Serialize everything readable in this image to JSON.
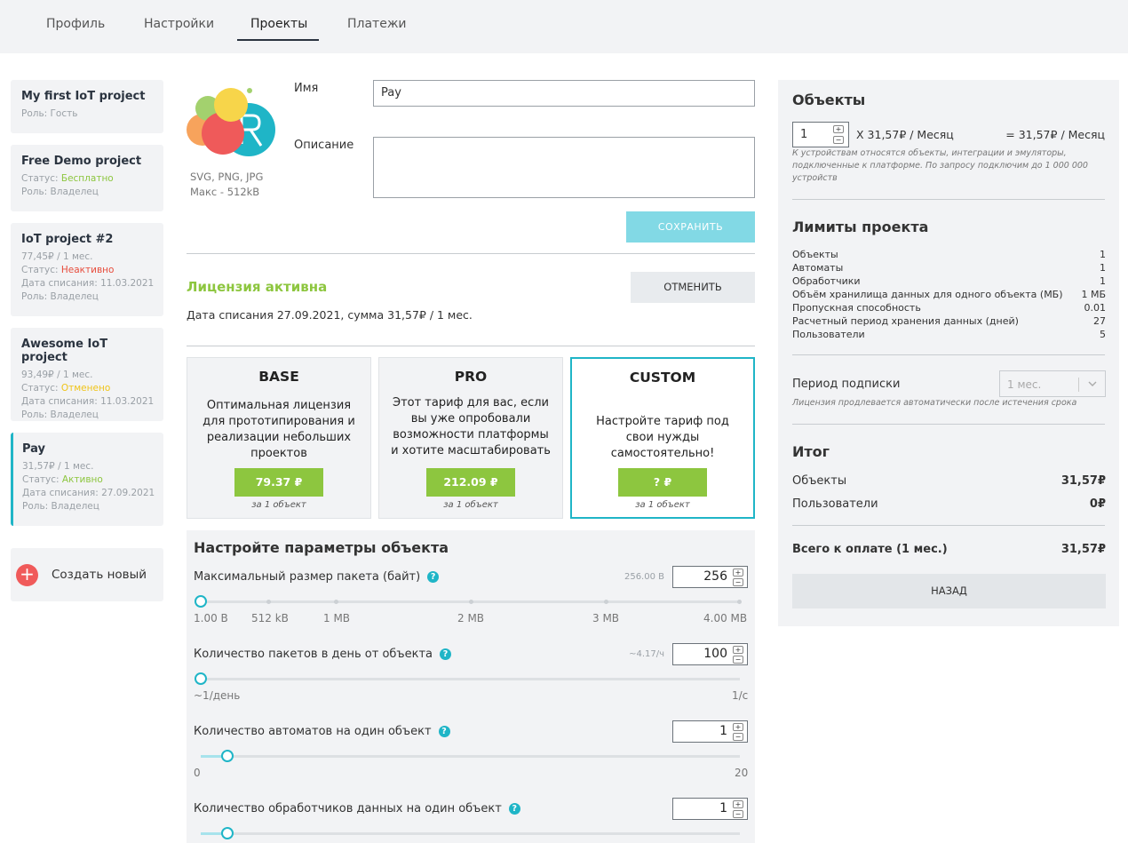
{
  "tabs": [
    {
      "label": "Профиль"
    },
    {
      "label": "Настройки"
    },
    {
      "label": "Проекты"
    },
    {
      "label": "Платежи"
    }
  ],
  "projects": [
    {
      "title": "My first IoT project",
      "role": "Роль: Гость"
    },
    {
      "title": "Free Demo project",
      "status_prefix": "Статус: ",
      "status": "Бесплатно",
      "role": "Роль: Владелец"
    },
    {
      "title": "IoT project #2",
      "price": "77,45₽ / 1 мес.",
      "status_prefix": "Статус: ",
      "status": "Неактивно",
      "date": "Дата списания: 11.03.2021",
      "role": "Роль: Владелец"
    },
    {
      "title": "Awesome IoT project",
      "price": "93,49₽ / 1 мес.",
      "status_prefix": "Статус: ",
      "status": "Отменено",
      "date": "Дата списания: 11.03.2021",
      "role": "Роль: Владелец"
    },
    {
      "title": "Pay",
      "price": "31,57₽ / 1 мес.",
      "status_prefix": "Статус: ",
      "status": "Активно",
      "date": "Дата списания: 27.09.2021",
      "role": "Роль: Владелец"
    }
  ],
  "create_label": "Создать новый",
  "logo": {
    "formats": "SVG, PNG, JPG",
    "max": "Макс - 512kB"
  },
  "form": {
    "name_label": "Имя",
    "name_value": "Pay",
    "desc_label": "Описание",
    "desc_value": "",
    "save_label": "СОХРАНИТЬ"
  },
  "license": {
    "status": "Лицензия активна",
    "cancel_label": "ОТМЕНИТЬ",
    "date_info": "Дата списания 27.09.2021, сумма 31,57₽ / 1 мес."
  },
  "plans": [
    {
      "name": "BASE",
      "desc": "Оптимальная лицензия для прототипирования и реализации небольших проектов",
      "price": "79.37 ₽",
      "unit": "за 1 объект"
    },
    {
      "name": "PRO",
      "desc": "Этот тариф для вас, если вы уже опробовали возможности платформы и хотите масштабировать",
      "price": "212.09 ₽",
      "unit": "за 1 объект"
    },
    {
      "name": "CUSTOM",
      "desc": "Настройте тариф под свои нужды самостоятельно!",
      "price": "? ₽",
      "unit": "за 1 объект"
    }
  ],
  "params": {
    "title": "Настройте параметры объекта",
    "packet_size": {
      "label": "Максимальный размер пакета (байт)",
      "hint": "256.00 B",
      "value": "256",
      "level": 0.0,
      "ticks": [
        "1.00 B",
        "512 kB",
        "1 MB",
        "2 MB",
        "3 MB",
        "4.00 MB"
      ]
    },
    "packets_per_day": {
      "label": "Количество пакетов в день от объекта",
      "hint": "~4.17/ч",
      "value": "100",
      "level": 0.0,
      "min": "~1/день",
      "max": "1/с"
    },
    "automata": {
      "label": "Количество автоматов на один объект",
      "value": "1",
      "level": 0.05,
      "min": "0",
      "max": "20"
    },
    "handlers": {
      "label": "Количество обработчиков данных на один объект",
      "value": "1",
      "level": 0.05
    }
  },
  "right": {
    "objects_title": "Объекты",
    "objects_count": "1",
    "multiplier": "X 31,57₽ / Месяц",
    "objects_total": "= 31,57₽ / Месяц",
    "objects_note": "К устройствам относятся объекты, интеграции и эмуляторы, подключенные к платформе. По запросу подключим до 1 000 000 устройств",
    "limits_title": "Лимиты проекта",
    "limits": [
      {
        "label": "Объекты",
        "value": "1"
      },
      {
        "label": "Автоматы",
        "value": "1"
      },
      {
        "label": "Обработчики",
        "value": "1"
      },
      {
        "label": "Объём хранилища данных для одного объекта (МБ)",
        "value": "1 МБ"
      },
      {
        "label": "Пропускная способность",
        "value": "0.01"
      },
      {
        "label": "Расчетный период хранения данных (дней)",
        "value": "27"
      },
      {
        "label": "Пользователи",
        "value": "5"
      }
    ],
    "period_label": "Период подписки",
    "period_value": "1 мес.",
    "period_note": "Лицензия продлевается автоматически после истечения срока",
    "total_title": "Итог",
    "total_rows": [
      {
        "label": "Объекты",
        "value": "31,57₽"
      },
      {
        "label": "Пользователи",
        "value": "0₽"
      }
    ],
    "grand_label": "Всего к оплате (1 мес.)",
    "grand_value": "31,57₽",
    "back_label": "НАЗАД"
  },
  "colors": {
    "accent": "#1fb5c7",
    "green": "#8dc63f",
    "red": "#e74c3c",
    "yellow": "#f0c419"
  }
}
